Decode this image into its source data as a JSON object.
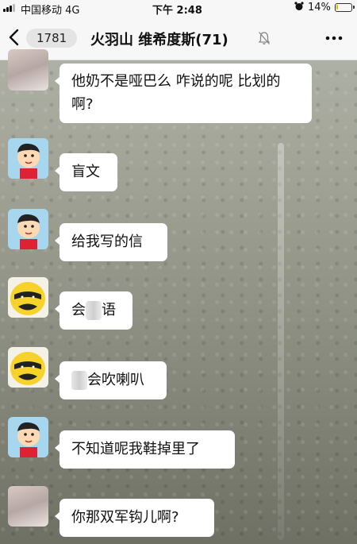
{
  "status_bar": {
    "carrier": "中国移动 4G",
    "time": "下午 2:48",
    "battery": "14%",
    "battery_level": 0.14
  },
  "nav": {
    "unread_count": "1781",
    "title": "火羽山 维希度斯(71)"
  },
  "messages": [
    {
      "text": "他奶不是哑巴么 咋说的呢 比划的啊?"
    },
    {
      "text": "盲文"
    },
    {
      "text": "给我写的信"
    },
    {
      "text_before": "会",
      "text_after": "语"
    },
    {
      "text_after": "会吹喇叭"
    },
    {
      "text": "不知道呢我鞋掉里了"
    },
    {
      "text": "你那双军钩儿啊?"
    }
  ]
}
